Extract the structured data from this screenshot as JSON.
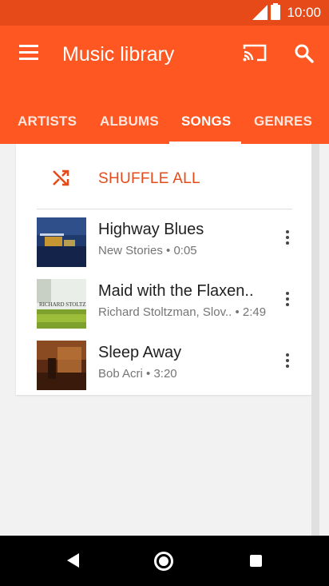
{
  "status_bar": {
    "time": "10:00"
  },
  "app_bar": {
    "title": "Music library",
    "icons": [
      "menu-icon",
      "cast-icon",
      "search-icon"
    ]
  },
  "tabs": [
    {
      "label": "ARTISTS"
    },
    {
      "label": "ALBUMS"
    },
    {
      "label": "SONGS",
      "active": true
    },
    {
      "label": "GENRES"
    }
  ],
  "shuffle": {
    "label": "SHUFFLE ALL",
    "icon": "shuffle-icon"
  },
  "songs": [
    {
      "title": "Highway Blues",
      "subtitle": "New Stories • 0:05"
    },
    {
      "title": "Maid with the Flaxen..",
      "subtitle": "Richard Stoltzman, Slov..  • 2:49"
    },
    {
      "title": "Sleep Away",
      "subtitle": "Bob Acri • 3:20"
    }
  ],
  "album_art_text": {
    "song_1": "RICHARD STOLTZMAN"
  },
  "colors": {
    "primary": "#ff5722",
    "status_bar": "#e64a19",
    "accent": "#e64a19"
  },
  "nav_bar": {
    "icons": [
      "back-icon",
      "home-icon",
      "recents-icon"
    ]
  }
}
